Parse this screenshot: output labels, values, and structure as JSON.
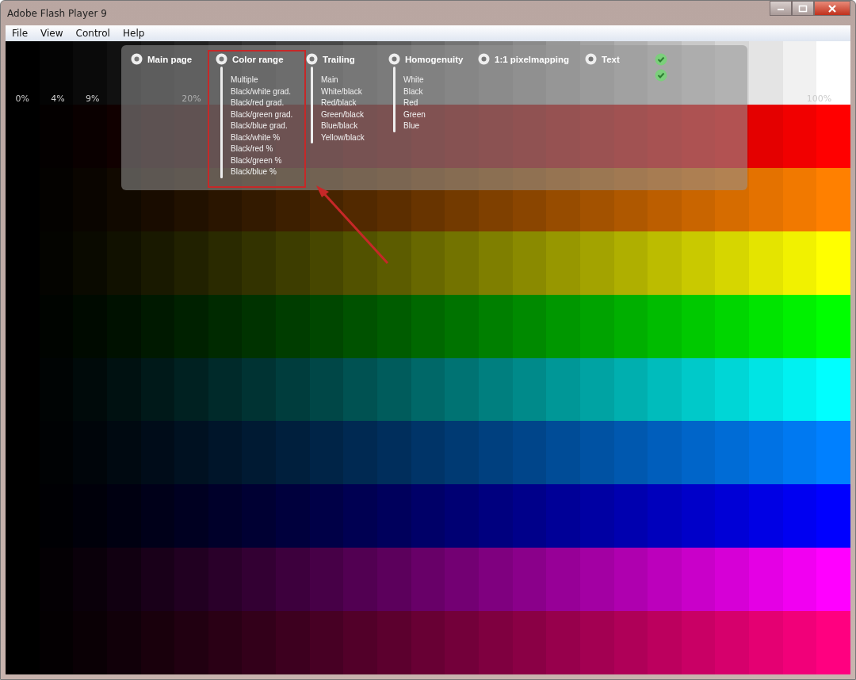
{
  "window": {
    "title": "Adobe Flash Player 9"
  },
  "menu": [
    "File",
    "View",
    "Control",
    "Help"
  ],
  "bands": [
    {
      "color": "#ffffff"
    },
    {
      "color": "#ff0000"
    },
    {
      "color": "#ff8000"
    },
    {
      "color": "#ffff00"
    },
    {
      "color": "#00ff00"
    },
    {
      "color": "#00ffff"
    },
    {
      "color": "#0080ff"
    },
    {
      "color": "#0000ff"
    },
    {
      "color": "#ff00ff"
    },
    {
      "color": "#ff0080"
    }
  ],
  "scale_labels": [
    "0%",
    "4%",
    "9%",
    "20%",
    "100%"
  ],
  "nav": [
    {
      "label": "Main page",
      "highlighted": false
    },
    {
      "label": "Color range",
      "highlighted": true,
      "items": [
        "Multiple",
        "Black/white grad.",
        "Black/red grad.",
        "Black/green grad.",
        "Black/blue grad.",
        "Black/white %",
        "Black/red %",
        "Black/green %",
        "Black/blue %"
      ]
    },
    {
      "label": "Trailing",
      "highlighted": false,
      "items": [
        "Main",
        "White/black",
        "Red/black",
        "Green/black",
        "Blue/black",
        "Yellow/black"
      ]
    },
    {
      "label": "Homogenuity",
      "highlighted": false,
      "items": [
        "White",
        "Black",
        "Red",
        "Green",
        "Blue"
      ]
    },
    {
      "label": "1:1 pixelmapping",
      "highlighted": false
    },
    {
      "label": "Text",
      "highlighted": false
    }
  ],
  "toggles": [
    {
      "checked": true
    },
    {
      "checked": true
    }
  ]
}
